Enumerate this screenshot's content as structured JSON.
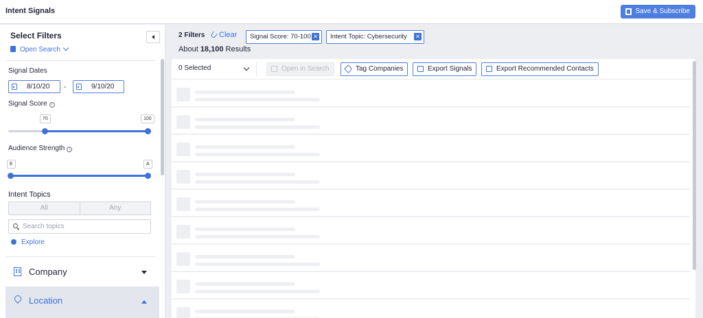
{
  "app": {
    "title": "Intent Signals",
    "save_label": "Save & Subscribe"
  },
  "sidebar": {
    "title": "Select Filters",
    "open_search_label": "Open Search",
    "signal_dates": {
      "label": "Signal Dates",
      "start": "8/10/20",
      "end": "9/10/20",
      "separator": "-"
    },
    "signal_score": {
      "label": "Signal Score",
      "min": 70,
      "max": 100,
      "min_label": "70",
      "max_label": "100",
      "range_min": 0,
      "range_max": 100
    },
    "audience_strength": {
      "label": "Audience Strength",
      "min_label": "E",
      "max_label": "A"
    },
    "intent_topics": {
      "label": "Intent Topics",
      "toggle_options": [
        "All",
        "Any"
      ],
      "search_placeholder": "Search topics",
      "explore_label": "Explore"
    },
    "sections": [
      {
        "label": "Company",
        "expanded": false
      },
      {
        "label": "Location",
        "expanded": true
      }
    ]
  },
  "main": {
    "filter_count": "2 Filters",
    "clear_label": "Clear",
    "chips": [
      {
        "label": "Signal Score: 70-100"
      },
      {
        "label": "Intent Topic: Cybersecurity"
      }
    ],
    "results_prefix": "About",
    "results_count": "18,100",
    "results_suffix": "Results",
    "toolbar": {
      "selected_label": "0 Selected",
      "open_in_search": "Open in Search",
      "tag_companies": "Tag Companies",
      "export_signals": "Export Signals",
      "export_contacts": "Export Recommended Contacts"
    },
    "skeleton_row_count": 9
  },
  "colors": {
    "accent": "#3f72d8",
    "button": "#4d7fe0",
    "background": "#eceef2"
  }
}
